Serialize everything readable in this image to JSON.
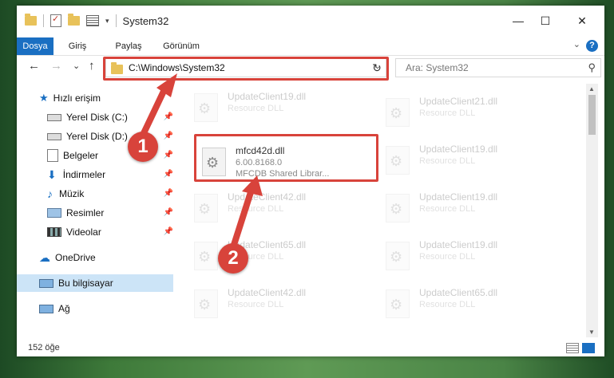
{
  "window": {
    "title": "System32",
    "controls": {
      "minimize": "—",
      "maximize": "☐",
      "close": "✕"
    }
  },
  "ribbon": {
    "tabs": [
      "Dosya",
      "Giriş",
      "Paylaş",
      "Görünüm"
    ],
    "active_tab": "Dosya",
    "help": "?"
  },
  "nav": {
    "back": "←",
    "forward": "→",
    "recent": "⌄",
    "up": "↑",
    "address": "C:\\Windows\\System32",
    "refresh": "↻",
    "search_placeholder": "Ara: System32",
    "search_icon": "search-icon"
  },
  "sidebar": {
    "items": [
      {
        "label": "Hızlı erişim",
        "icon": "star-icon"
      },
      {
        "label": "Yerel Disk (C:)",
        "icon": "drive-icon"
      },
      {
        "label": "Yerel Disk (D:)",
        "icon": "drive-icon"
      },
      {
        "label": "Belgeler",
        "icon": "documents-icon"
      },
      {
        "label": "İndirmeler",
        "icon": "download-icon"
      },
      {
        "label": "Müzik",
        "icon": "music-icon"
      },
      {
        "label": "Resimler",
        "icon": "pictures-icon"
      },
      {
        "label": "Videolar",
        "icon": "video-icon"
      },
      {
        "label": "OneDrive",
        "icon": "cloud-icon"
      },
      {
        "label": "Bu bilgisayar",
        "icon": "computer-icon"
      },
      {
        "label": "Ağ",
        "icon": "network-icon"
      }
    ],
    "selected": "Bu bilgisayar"
  },
  "files": {
    "highlighted": {
      "name": "mfcd42d.dll",
      "version": "6.00.8168.0",
      "description": "MFCDB Shared Librar..."
    },
    "left_column": [
      {
        "name": "UpdateClient19.dll",
        "type": "Resource DLL"
      },
      {
        "name": "UpdateClient42.dll",
        "type": "Resource DLL"
      },
      {
        "name": "UpdateClient65.dll",
        "type": "Resource DLL"
      },
      {
        "name": "UpdateClient42.dll",
        "type": "Resource DLL"
      }
    ],
    "right_column": [
      {
        "name": "UpdateClient21.dll",
        "type": "Resource DLL"
      },
      {
        "name": "UpdateClient19.dll",
        "type": "Resource DLL"
      },
      {
        "name": "UpdateClient19.dll",
        "type": "Resource DLL"
      },
      {
        "name": "UpdateClient19.dll",
        "type": "Resource DLL"
      },
      {
        "name": "UpdateClient65.dll",
        "type": "Resource DLL"
      }
    ]
  },
  "status": {
    "count": "152 öğe"
  },
  "callouts": [
    "1",
    "2"
  ],
  "colors": {
    "accent": "#1a6fc2",
    "highlight": "#d8433b",
    "selected": "#cce4f7"
  }
}
